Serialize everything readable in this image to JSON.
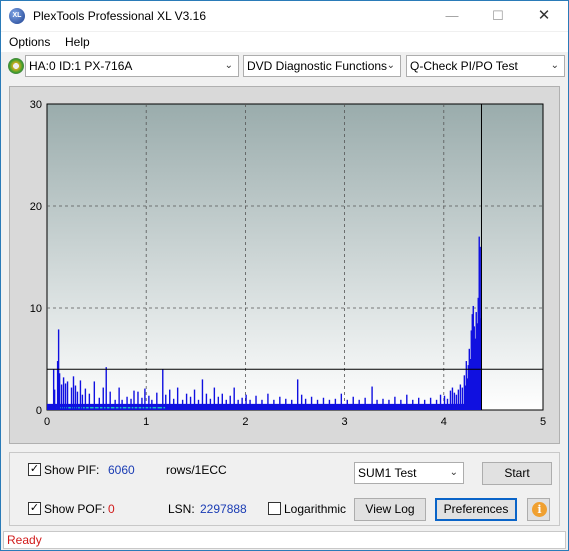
{
  "window": {
    "title": "PlexTools Professional XL V3.16",
    "icon_text": "XL",
    "minimize_glyph": "—",
    "maximize_glyph": "☐",
    "close_glyph": "✕"
  },
  "menu": {
    "items": [
      "Options",
      "Help"
    ]
  },
  "toolbar": {
    "drive": "HA:0 ID:1  PX-716A",
    "function": "DVD Diagnostic Functions",
    "test": "Q-Check PI/PO Test",
    "dropdown_glyph": "⌄"
  },
  "chart_data": {
    "type": "bar",
    "x_ticks": [
      "0",
      "1",
      "2",
      "3",
      "4",
      "5"
    ],
    "y_ticks": [
      "0",
      "10",
      "20",
      "30"
    ],
    "xlim": [
      0,
      5
    ],
    "ylim": [
      0,
      30
    ],
    "grid": true,
    "threshold_line": 4,
    "end_marker_x": 4.38,
    "colors": {
      "bars": "#1010e0",
      "pof": "#20c0c0",
      "plot_bg_top": "#9aacac",
      "plot_bg_bottom": "#ffffff"
    },
    "spikes": [
      [
        0.06,
        4
      ],
      [
        0.07,
        2
      ],
      [
        0.1,
        4.8
      ],
      [
        0.11,
        7.9
      ],
      [
        0.12,
        3.6
      ],
      [
        0.14,
        2.5
      ],
      [
        0.16,
        3.2
      ],
      [
        0.18,
        2.6
      ],
      [
        0.2,
        2.8
      ],
      [
        0.24,
        2.2
      ],
      [
        0.26,
        3.3
      ],
      [
        0.28,
        2.4
      ],
      [
        0.3,
        1.8
      ],
      [
        0.33,
        2.9
      ],
      [
        0.35,
        1.5
      ],
      [
        0.38,
        2.1
      ],
      [
        0.42,
        1.6
      ],
      [
        0.47,
        2.8
      ],
      [
        0.52,
        1.2
      ],
      [
        0.56,
        2.2
      ],
      [
        0.59,
        4.2
      ],
      [
        0.63,
        1.8
      ],
      [
        0.68,
        1.0
      ],
      [
        0.72,
        2.2
      ],
      [
        0.75,
        1.0
      ],
      [
        0.8,
        1.3
      ],
      [
        0.84,
        1.1
      ],
      [
        0.87,
        1.9
      ],
      [
        0.91,
        1.8
      ],
      [
        0.95,
        1.2
      ],
      [
        0.98,
        2.1
      ],
      [
        1.02,
        1.4
      ],
      [
        1.05,
        1.0
      ],
      [
        1.1,
        1.7
      ],
      [
        1.16,
        4.0
      ],
      [
        1.19,
        1.5
      ],
      [
        1.23,
        2.0
      ],
      [
        1.27,
        1.1
      ],
      [
        1.31,
        2.2
      ],
      [
        1.36,
        1.0
      ],
      [
        1.4,
        1.6
      ],
      [
        1.44,
        1.3
      ],
      [
        1.48,
        2.0
      ],
      [
        1.52,
        1.0
      ],
      [
        1.56,
        3.0
      ],
      [
        1.6,
        1.6
      ],
      [
        1.64,
        1.1
      ],
      [
        1.68,
        2.2
      ],
      [
        1.72,
        1.3
      ],
      [
        1.76,
        1.6
      ],
      [
        1.8,
        1.0
      ],
      [
        1.84,
        1.4
      ],
      [
        1.88,
        2.2
      ],
      [
        1.92,
        1.0
      ],
      [
        1.96,
        1.2
      ],
      [
        2.0,
        1.5
      ],
      [
        2.04,
        1.0
      ],
      [
        2.1,
        1.4
      ],
      [
        2.16,
        1.0
      ],
      [
        2.22,
        1.6
      ],
      [
        2.28,
        1.0
      ],
      [
        2.34,
        1.3
      ],
      [
        2.4,
        1.1
      ],
      [
        2.46,
        1.0
      ],
      [
        2.52,
        3.0
      ],
      [
        2.56,
        1.5
      ],
      [
        2.6,
        1.1
      ],
      [
        2.66,
        1.3
      ],
      [
        2.72,
        1.0
      ],
      [
        2.78,
        1.2
      ],
      [
        2.84,
        1.0
      ],
      [
        2.9,
        1.1
      ],
      [
        2.96,
        1.6
      ],
      [
        3.02,
        1.0
      ],
      [
        3.08,
        1.3
      ],
      [
        3.14,
        1.0
      ],
      [
        3.2,
        1.2
      ],
      [
        3.27,
        2.3
      ],
      [
        3.32,
        1.0
      ],
      [
        3.38,
        1.1
      ],
      [
        3.44,
        1.0
      ],
      [
        3.5,
        1.3
      ],
      [
        3.56,
        1.0
      ],
      [
        3.62,
        1.5
      ],
      [
        3.68,
        1.0
      ],
      [
        3.74,
        1.2
      ],
      [
        3.8,
        1.0
      ],
      [
        3.86,
        1.2
      ],
      [
        3.92,
        1.0
      ],
      [
        3.96,
        1.5
      ],
      [
        4.0,
        1.4
      ],
      [
        4.03,
        1.1
      ],
      [
        4.06,
        1.9
      ],
      [
        4.08,
        2.2
      ],
      [
        4.1,
        1.7
      ],
      [
        4.12,
        1.5
      ],
      [
        4.14,
        2.0
      ],
      [
        4.16,
        2.5
      ],
      [
        4.18,
        2.2
      ],
      [
        4.2,
        3.4
      ],
      [
        4.21,
        2.4
      ],
      [
        4.22,
        4.8
      ],
      [
        4.23,
        3.1
      ],
      [
        4.24,
        4.4
      ],
      [
        4.25,
        6.0
      ],
      [
        4.26,
        5.0
      ],
      [
        4.27,
        7.8
      ],
      [
        4.28,
        9.4
      ],
      [
        4.29,
        10.2
      ],
      [
        4.3,
        8.2
      ],
      [
        4.31,
        7.0
      ],
      [
        4.32,
        9.6
      ],
      [
        4.33,
        8.5
      ],
      [
        4.34,
        11.0
      ],
      [
        4.35,
        17.0
      ],
      [
        4.36,
        16.0
      ],
      [
        4.37,
        9.0
      ]
    ],
    "baseline_end_x": 4.38,
    "pof_end_x": 1.2
  },
  "controls": {
    "show_pif_label": "Show PIF:",
    "pif_value": "6060",
    "pif_unit": "rows/1ECC",
    "show_pof_label": "Show POF:",
    "pof_value": "0",
    "lsn_label": "LSN:",
    "lsn_value": "2297888",
    "logarithmic_label": "Logarithmic",
    "mode_select": "SUM1 Test",
    "start_button": "Start",
    "view_log_button": "View Log",
    "preferences_button": "Preferences",
    "info_glyph": "i",
    "pif_checked": true,
    "pof_checked": true,
    "log_checked": false,
    "check_glyph": "✓"
  },
  "status": {
    "text": "Ready"
  }
}
